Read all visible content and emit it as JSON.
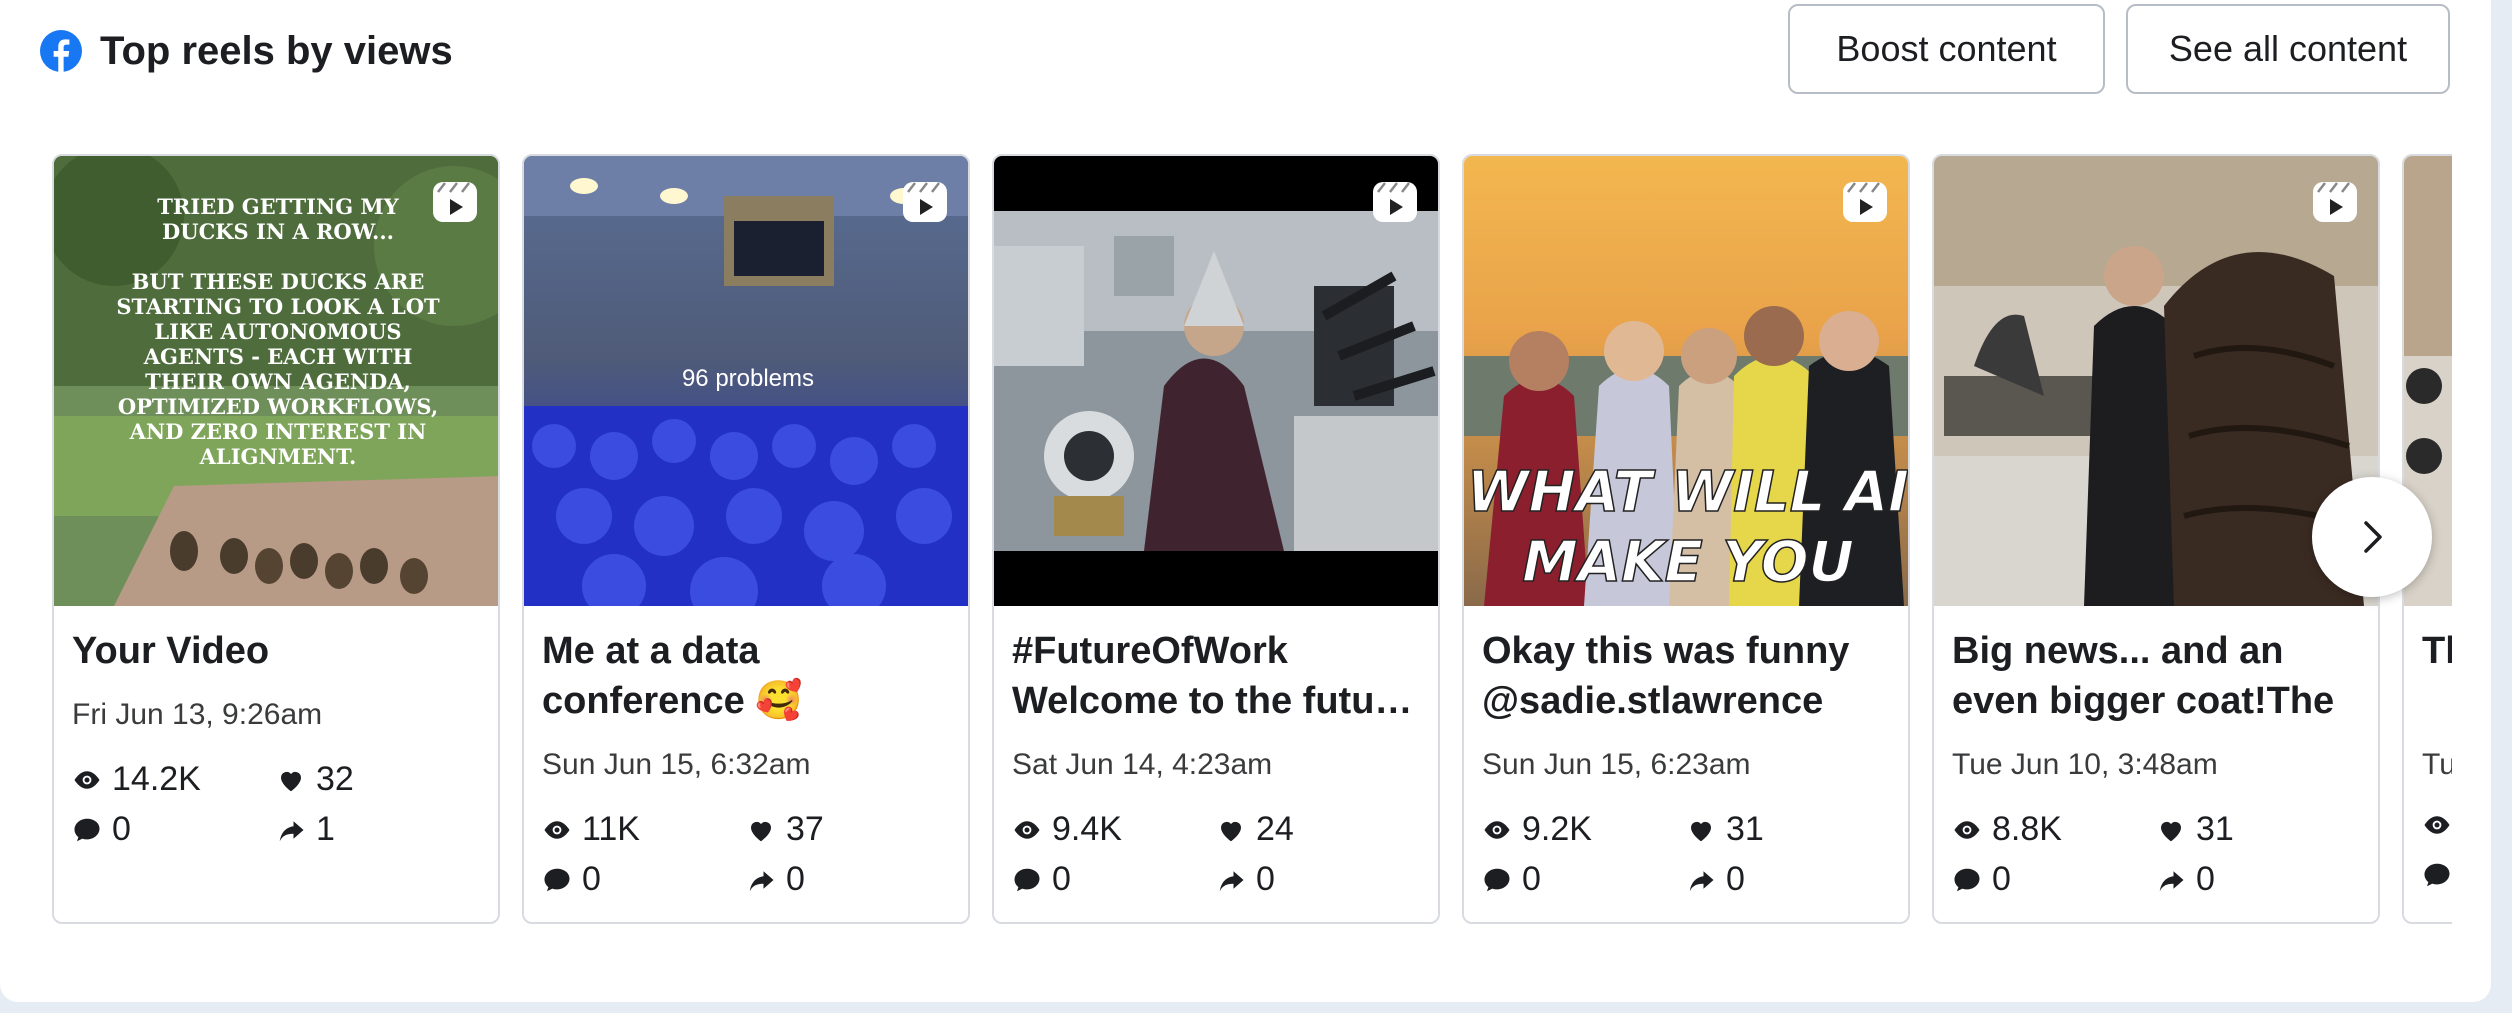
{
  "header": {
    "title": "Top reels by views",
    "boost_label": "Boost content",
    "see_all_label": "See all content",
    "logo_icon": "facebook-icon"
  },
  "colors": {
    "facebook_blue": "#1877f2",
    "border": "#d8dbe0"
  },
  "reels": [
    {
      "caption": "Your Video",
      "date": "Fri Jun 13, 9:26am",
      "views": "14.2K",
      "likes": "32",
      "comments": "0",
      "shares": "1",
      "thumb_text": [
        "TRIED GETTING MY",
        "DUCKS IN A ROW...",
        "",
        "BUT THESE DUCKS ARE",
        "STARTING TO LOOK A LOT",
        "LIKE AUTONOMOUS",
        "AGENTS - EACH WITH",
        "THEIR OWN AGENDA,",
        "OPTIMIZED WORKFLOWS,",
        "AND ZERO INTEREST IN",
        "ALIGNMENT."
      ]
    },
    {
      "caption": "Me at a data conference 🥰",
      "date": "Sun Jun 15, 6:32am",
      "views": "11K",
      "likes": "37",
      "comments": "0",
      "shares": "0",
      "thumb_text": [
        "96 problems"
      ]
    },
    {
      "caption": "#FutureOfWork Welcome to the future of work",
      "date": "Sat Jun 14, 4:23am",
      "views": "9.4K",
      "likes": "24",
      "comments": "0",
      "shares": "0",
      "thumb_text": []
    },
    {
      "caption": "Okay this was funny @sadie.stlawrence",
      "date": "Sun Jun 15, 6:23am",
      "views": "9.2K",
      "likes": "31",
      "comments": "0",
      "shares": "0",
      "thumb_text": [
        "WHAT WILL AI",
        "MAKE YOU"
      ]
    },
    {
      "caption": "Big news... and an even bigger coat!The",
      "date": "Tue Jun 10, 3:48am",
      "views": "8.8K",
      "likes": "31",
      "comments": "0",
      "shares": "0",
      "thumb_text": []
    },
    {
      "caption": "Th la",
      "date": "Tu",
      "views": "",
      "likes": "",
      "comments": "",
      "shares": "",
      "thumb_text": []
    }
  ]
}
